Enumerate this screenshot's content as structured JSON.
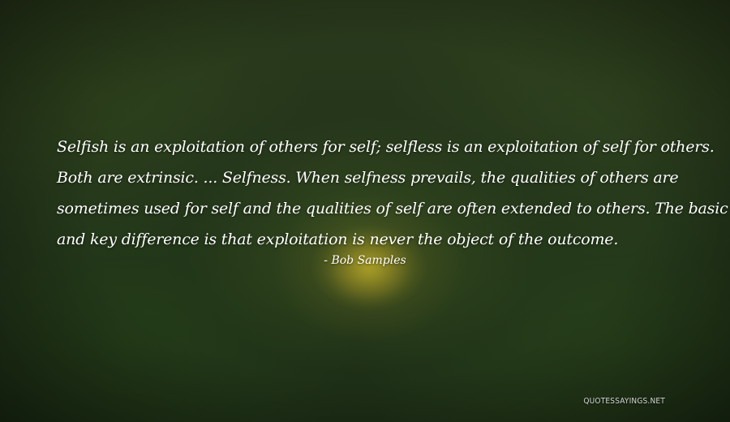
{
  "quote": {
    "lines": [
      "Selfish is an exploitation of others for self; selfless is an exploitation of self for others.",
      "Both are extrinsic. ... Selfness. When selfness prevails, the qualities of others are",
      "sometimes used for self and the qualities of self are often extended to others. The basic",
      "and key difference is that exploitation is never the object of the outcome."
    ]
  },
  "author": "- Bob Samples",
  "watermark": "QUOTESSAYINGS.NET",
  "colors": {
    "text": "#ffffff",
    "background_dark": "#1d2e16",
    "flower_yellow": "#d2be2d"
  }
}
